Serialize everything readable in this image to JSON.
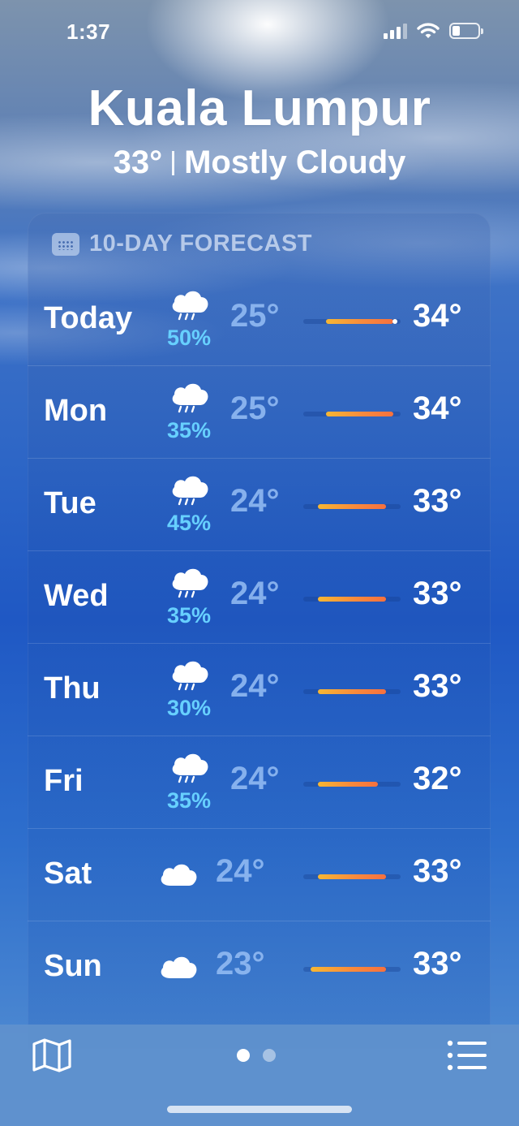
{
  "status_bar": {
    "time": "1:37",
    "icons": [
      "cellular-signal-icon",
      "wifi-icon",
      "battery-icon"
    ],
    "battery_level": 0.25
  },
  "location": {
    "city": "Kuala Lumpur",
    "current_temp": "33°",
    "condition": "Mostly Cloudy"
  },
  "forecast": {
    "title": "10-DAY FORECAST",
    "icon": "calendar-icon",
    "days": [
      {
        "day": "Today",
        "icon": "cloud-rain-icon",
        "precip": "50%",
        "low": "25°",
        "high": "34°",
        "low_val": 25,
        "high_val": 34,
        "current_val": 33
      },
      {
        "day": "Mon",
        "icon": "cloud-rain-icon",
        "precip": "35%",
        "low": "25°",
        "high": "34°",
        "low_val": 25,
        "high_val": 34
      },
      {
        "day": "Tue",
        "icon": "cloud-rain-icon",
        "precip": "45%",
        "low": "24°",
        "high": "33°",
        "low_val": 24,
        "high_val": 33
      },
      {
        "day": "Wed",
        "icon": "cloud-rain-icon",
        "precip": "35%",
        "low": "24°",
        "high": "33°",
        "low_val": 24,
        "high_val": 33
      },
      {
        "day": "Thu",
        "icon": "cloud-rain-icon",
        "precip": "30%",
        "low": "24°",
        "high": "33°",
        "low_val": 24,
        "high_val": 33
      },
      {
        "day": "Fri",
        "icon": "cloud-rain-icon",
        "precip": "35%",
        "low": "24°",
        "high": "32°",
        "low_val": 24,
        "high_val": 32
      },
      {
        "day": "Sat",
        "icon": "cloud-icon",
        "precip": "",
        "low": "24°",
        "high": "33°",
        "low_val": 24,
        "high_val": 33
      },
      {
        "day": "Sun",
        "icon": "cloud-icon",
        "precip": "",
        "low": "23°",
        "high": "33°",
        "low_val": 23,
        "high_val": 33
      }
    ]
  },
  "toolbar": {
    "map_icon": "map-icon",
    "list_icon": "list-icon",
    "page_count": 2,
    "active_page": 0
  },
  "colors": {
    "precip": "#67d0ff",
    "bar_start": "#f7b733",
    "bar_end": "#f6713f"
  }
}
